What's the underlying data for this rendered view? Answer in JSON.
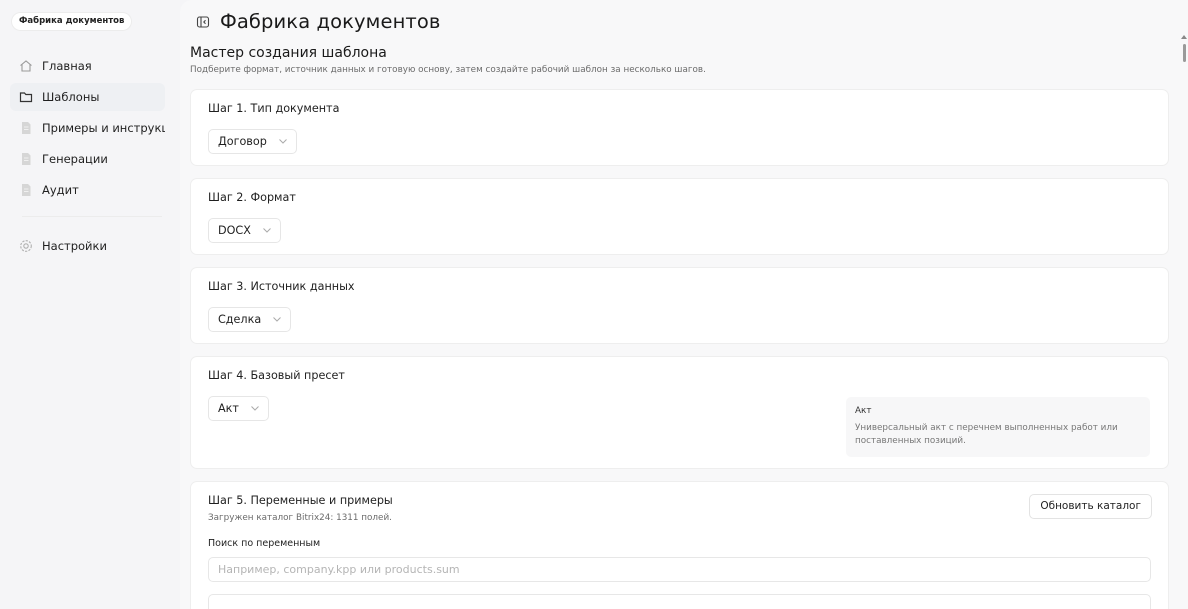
{
  "app": {
    "badge": "Фабрика документов"
  },
  "sidebar": {
    "items": [
      {
        "label": "Главная",
        "icon": "home-icon"
      },
      {
        "label": "Шаблоны",
        "icon": "folder-icon"
      },
      {
        "label": "Примеры и инструкции",
        "icon": "document-icon"
      },
      {
        "label": "Генерации",
        "icon": "document-icon"
      },
      {
        "label": "Аудит",
        "icon": "document-icon"
      },
      {
        "label": "Настройки",
        "icon": "gear-icon"
      }
    ],
    "active_index": 1
  },
  "header": {
    "title": "Фабрика документов",
    "toggle_icon": "sidebar-toggle-icon"
  },
  "wizard": {
    "title": "Мастер создания шаблона",
    "subtitle": "Подберите формат, источник данных и готовую основу, затем создайте рабочий шаблон за несколько шагов."
  },
  "steps": {
    "s1": {
      "title": "Шаг 1. Тип документа",
      "value": "Договор"
    },
    "s2": {
      "title": "Шаг 2. Формат",
      "value": "DOCX"
    },
    "s3": {
      "title": "Шаг 3. Источник данных",
      "value": "Сделка"
    },
    "s4": {
      "title": "Шаг 4. Базовый пресет",
      "value": "Акт",
      "preset_name": "Акт",
      "preset_desc_line1": "Универсальный акт с перечнем выполненных работ или",
      "preset_desc_line2": "поставленных позиций."
    },
    "s5": {
      "title": "Шаг 5. Переменные и примеры",
      "subtitle": "Загружен каталог Bitrix24: 1311 полей.",
      "refresh_label": "Обновить каталог",
      "search_label": "Поиск по переменным",
      "search_placeholder": "Например, company.kpp или products.sum"
    }
  },
  "colors": {
    "background": "#f5f5f7",
    "card": "#ffffff",
    "border": "#e6e6e6"
  }
}
